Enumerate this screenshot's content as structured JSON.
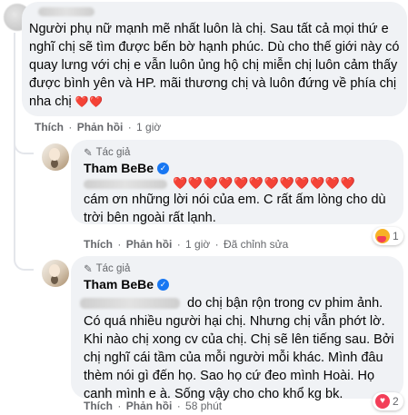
{
  "comments": [
    {
      "text": "Người phụ nữ mạnh mẽ nhất luôn là chị. Sau tất cả mọi thứ e nghĩ chị sẽ tìm được bến bờ hạnh phúc. Dù cho thế giới này có quay lưng với chị e vẫn luôn ủng hộ chị miễn chị luôn cảm thấy được bình yên và HP. mãi thương chị và luôn đứng về phía chị nha chị",
      "emoji": "❤️❤️",
      "actions": {
        "like": "Thích",
        "reply": "Phản hồi",
        "time": "1 giờ"
      }
    },
    {
      "author_tag": "Tác giả",
      "author": "Tham BeBe",
      "hearts": "❤️❤️❤️❤️❤️❤️❤️❤️❤️❤️❤️❤️",
      "text": "cám ơn những lời nói của em. C rất ấm lòng cho dù trời bên ngoài rất lạnh.",
      "actions": {
        "like": "Thích",
        "reply": "Phản hồi",
        "time": "1 giờ",
        "edited": "Đã chỉnh sửa"
      },
      "reaction_count": "1"
    },
    {
      "author_tag": "Tác giả",
      "author": "Tham BeBe",
      "text_first": "do chị bận rộn trong cv phim ảnh.",
      "text_rest": "Có quá nhiều người hại chị. Nhưng chị vẫn phớt lờ. Khi nào chị xong cv của chị. Chị sẽ lên tiếng sau. Bởi chị nghĩ cái tầm của mỗi người mỗi khác. Mình đâu thèm nói gì đến họ. Sao họ cứ đeo mình Hoài. Họ canh mình e à. Sống vậy cho cho khổ kg bk.",
      "actions": {
        "like": "Thích",
        "reply": "Phản hồi",
        "time": "58 phút"
      },
      "reaction_count": "2"
    }
  ],
  "icons": {
    "author": "pencil-icon",
    "verified": "verified-check-icon",
    "care": "care-reaction-icon",
    "love": "love-reaction-icon"
  },
  "colors": {
    "bubble": "#f0f2f5",
    "meta": "#65676b",
    "verified": "#1877f2",
    "heart": "#e0263a"
  }
}
